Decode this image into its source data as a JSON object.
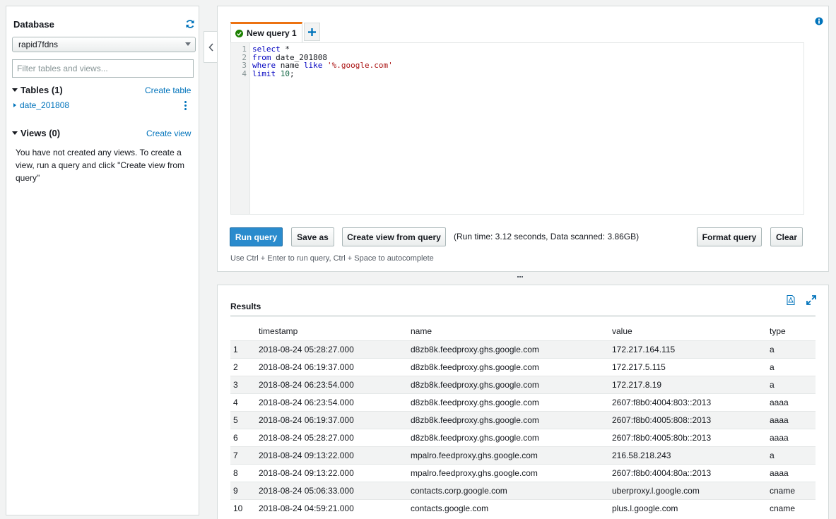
{
  "sidebar": {
    "title": "Database",
    "database_selected": "rapid7fdns",
    "filter_placeholder": "Filter tables and views...",
    "tables_header": "Tables (1)",
    "create_table_link": "Create table",
    "tables": [
      "date_201808"
    ],
    "views_header": "Views (0)",
    "create_view_link": "Create view",
    "views_message": "You have not created any views. To create a view, run a query and click \"Create view from query\""
  },
  "editor": {
    "tab_label": "New query 1",
    "line_numbers": [
      "1",
      "2",
      "3",
      "4"
    ],
    "query_lines": [
      [
        {
          "t": "select",
          "c": "kw"
        },
        {
          "t": " *",
          "c": "txt"
        }
      ],
      [
        {
          "t": "from",
          "c": "kw"
        },
        {
          "t": " date_201808",
          "c": "txt"
        }
      ],
      [
        {
          "t": "where",
          "c": "kw"
        },
        {
          "t": " name ",
          "c": "txt"
        },
        {
          "t": "like",
          "c": "kw"
        },
        {
          "t": " ",
          "c": "txt"
        },
        {
          "t": "'%.google.com'",
          "c": "str"
        }
      ],
      [
        {
          "t": "limit",
          "c": "kw"
        },
        {
          "t": " ",
          "c": "txt"
        },
        {
          "t": "10",
          "c": "num"
        },
        {
          "t": ";",
          "c": "txt"
        }
      ]
    ],
    "run_button": "Run query",
    "save_button": "Save as",
    "create_view_button": "Create view from query",
    "run_info": "(Run time: 3.12 seconds, Data scanned: 3.86GB)",
    "format_button": "Format query",
    "clear_button": "Clear",
    "hint": "Use Ctrl + Enter to run query, Ctrl + Space to autocomplete"
  },
  "results": {
    "title": "Results",
    "columns": [
      "",
      "timestamp",
      "name",
      "value",
      "type"
    ],
    "rows": [
      [
        "1",
        "2018-08-24 05:28:27.000",
        "d8zb8k.feedproxy.ghs.google.com",
        "172.217.164.115",
        "a"
      ],
      [
        "2",
        "2018-08-24 06:19:37.000",
        "d8zb8k.feedproxy.ghs.google.com",
        "172.217.5.115",
        "a"
      ],
      [
        "3",
        "2018-08-24 06:23:54.000",
        "d8zb8k.feedproxy.ghs.google.com",
        "172.217.8.19",
        "a"
      ],
      [
        "4",
        "2018-08-24 06:23:54.000",
        "d8zb8k.feedproxy.ghs.google.com",
        "2607:f8b0:4004:803::2013",
        "aaaa"
      ],
      [
        "5",
        "2018-08-24 06:19:37.000",
        "d8zb8k.feedproxy.ghs.google.com",
        "2607:f8b0:4005:808::2013",
        "aaaa"
      ],
      [
        "6",
        "2018-08-24 05:28:27.000",
        "d8zb8k.feedproxy.ghs.google.com",
        "2607:f8b0:4005:80b::2013",
        "aaaa"
      ],
      [
        "7",
        "2018-08-24 09:13:22.000",
        "mpalro.feedproxy.ghs.google.com",
        "216.58.218.243",
        "a"
      ],
      [
        "8",
        "2018-08-24 09:13:22.000",
        "mpalro.feedproxy.ghs.google.com",
        "2607:f8b0:4004:80a::2013",
        "aaaa"
      ],
      [
        "9",
        "2018-08-24 05:06:33.000",
        "contacts.corp.google.com",
        "uberproxy.l.google.com",
        "cname"
      ],
      [
        "10",
        "2018-08-24 04:59:21.000",
        "contacts.google.com",
        "plus.l.google.com",
        "cname"
      ]
    ]
  },
  "icons": {
    "refresh": "refresh-icon",
    "info": "info-icon",
    "success": "check-circle-icon",
    "add_tab": "plus-icon",
    "collapse": "chevron-left-icon",
    "download": "download-icon",
    "expand": "expand-icon"
  },
  "colors": {
    "accent_blue": "#0073bb",
    "primary_button": "#2a8bcd",
    "active_tab_border": "#ec7211",
    "success_green": "#1d8102"
  }
}
